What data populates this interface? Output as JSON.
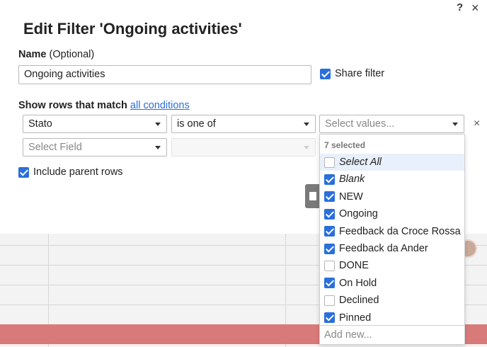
{
  "dialog": {
    "title": "Edit Filter 'Ongoing activities'",
    "help_icon": "?",
    "close_icon": "×",
    "name_label": "Name",
    "name_optional": "(Optional)",
    "name_value": "Ongoing activities",
    "share_label": "Share filter",
    "share_checked": true,
    "match_prefix": "Show rows that match",
    "match_link": "all conditions",
    "condition": {
      "field": "Stato",
      "operator": "is one of",
      "values_placeholder": "Select values...",
      "remove": "×"
    },
    "new_condition": {
      "field_placeholder": "Select Field"
    },
    "include_parent_label": "Include parent rows",
    "include_parent_checked": true
  },
  "values_dropdown": {
    "selected_count": "7 selected",
    "items": [
      {
        "label": "Select All",
        "checked": false,
        "italic": true
      },
      {
        "label": "Blank",
        "checked": true,
        "italic": true
      },
      {
        "label": "NEW",
        "checked": true,
        "italic": false
      },
      {
        "label": "Ongoing",
        "checked": true,
        "italic": false
      },
      {
        "label": "Feedback da Croce Rossa",
        "checked": true,
        "italic": false
      },
      {
        "label": "Feedback da Ander",
        "checked": true,
        "italic": false
      },
      {
        "label": "DONE",
        "checked": false,
        "italic": false
      },
      {
        "label": "On Hold",
        "checked": true,
        "italic": false
      },
      {
        "label": "Declined",
        "checked": false,
        "italic": false
      },
      {
        "label": "Pinned",
        "checked": true,
        "italic": false
      }
    ],
    "add_new_placeholder": "Add new..."
  },
  "colors": {
    "accent": "#2a6fdb",
    "row_highlight": "#d97a7a"
  }
}
